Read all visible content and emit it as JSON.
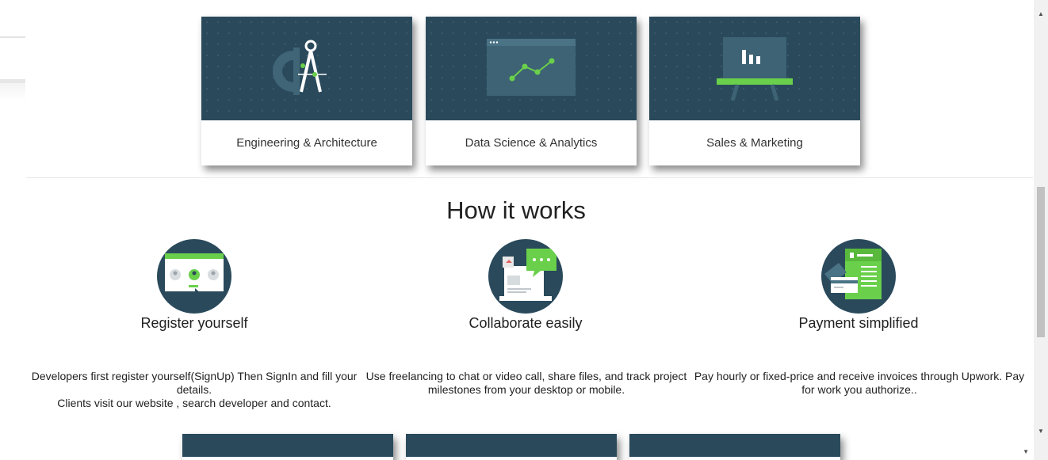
{
  "categories": [
    {
      "label": "Engineering & Architecture",
      "icon": "compass-icon"
    },
    {
      "label": "Data Science & Analytics",
      "icon": "line-chart-window-icon"
    },
    {
      "label": "Sales & Marketing",
      "icon": "presentation-board-icon"
    }
  ],
  "how_it_works": {
    "title": "How it works",
    "steps": [
      {
        "title": "Register yourself",
        "icon": "register-users-icon",
        "description_line1": "Developers first register yourself(SignUp) Then SignIn and fill your details.",
        "description_line2": "Clients visit our website , search developer and contact."
      },
      {
        "title": "Collaborate easily",
        "icon": "chat-laptop-icon",
        "description_line1": "Use freelancing to chat or video call, share files, and track project milestones from your desktop or mobile."
      },
      {
        "title": "Payment simplified",
        "icon": "invoice-card-icon",
        "description_line1": "Pay hourly or fixed-price and receive invoices through Upwork. Pay for work you authorize.."
      }
    ]
  },
  "colors": {
    "card_bg": "#2a4a5c",
    "accent_green": "#6ad04b",
    "text": "#222222"
  }
}
